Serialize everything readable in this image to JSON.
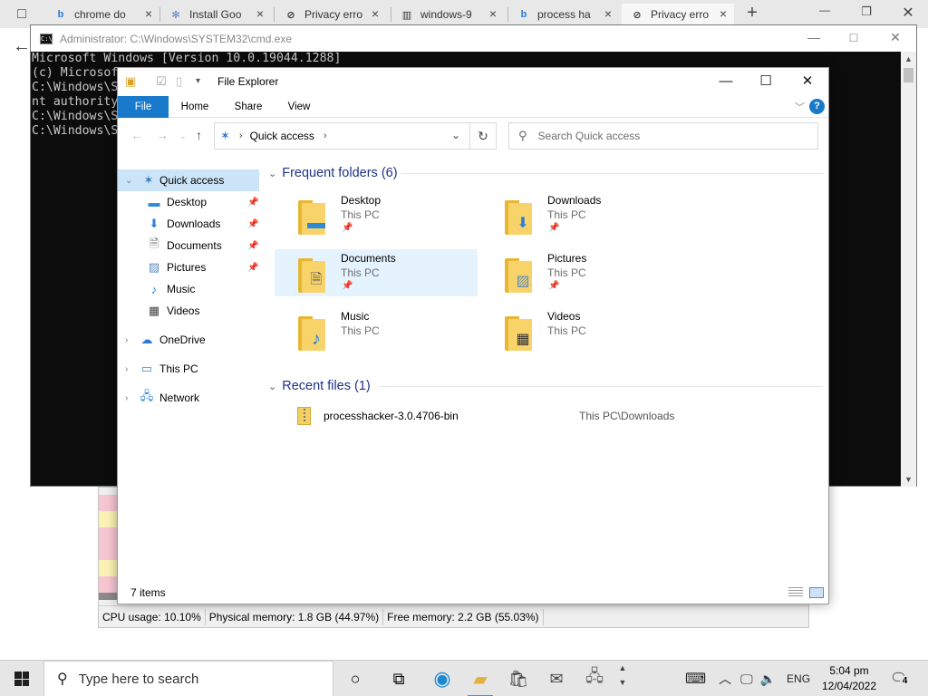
{
  "browser": {
    "tabs": [
      {
        "label": "chrome do",
        "icon": "bing-icon"
      },
      {
        "label": "Install Goo",
        "icon": "google-cloud-icon"
      },
      {
        "label": "Privacy erro",
        "icon": "privacy-error-icon"
      },
      {
        "label": "windows-9",
        "icon": "archive-icon"
      },
      {
        "label": "process ha",
        "icon": "bing-icon"
      },
      {
        "label": "Privacy erro",
        "icon": "privacy-error-icon"
      }
    ],
    "new_tab": "+"
  },
  "cmd": {
    "title": "Administrator: C:\\Windows\\SYSTEM32\\cmd.exe",
    "lines": [
      "Microsoft Windows [Version 10.0.19044.1288]",
      "(c) Microsof",
      "",
      "C:\\Windows\\S",
      "nt authority",
      "",
      "C:\\Windows\\S",
      "",
      "C:\\Windows\\S"
    ]
  },
  "process_hacker": {
    "status": [
      "CPU usage: 10.10%",
      "Physical memory: 1.8 GB (44.97%)",
      "Free memory: 2.2 GB (55.03%)"
    ]
  },
  "explorer": {
    "title": "File Explorer",
    "ribbon_tabs": [
      "File",
      "Home",
      "Share",
      "View"
    ],
    "help": "?",
    "address": {
      "location": "Quick access"
    },
    "search_placeholder": "Search Quick access",
    "nav": {
      "quick_access": "Quick access",
      "pinned": [
        "Desktop",
        "Downloads",
        "Documents",
        "Pictures"
      ],
      "unpinned": [
        "Music",
        "Videos"
      ],
      "onedrive": "OneDrive",
      "this_pc": "This PC",
      "network": "Network"
    },
    "frequent": {
      "header": "Frequent folders (6)",
      "items": [
        {
          "name": "Desktop",
          "location": "This PC",
          "pinned": true
        },
        {
          "name": "Downloads",
          "location": "This PC",
          "pinned": true
        },
        {
          "name": "Documents",
          "location": "This PC",
          "pinned": true
        },
        {
          "name": "Pictures",
          "location": "This PC",
          "pinned": true
        },
        {
          "name": "Music",
          "location": "This PC",
          "pinned": false
        },
        {
          "name": "Videos",
          "location": "This PC",
          "pinned": false
        }
      ]
    },
    "recent": {
      "header": "Recent files (1)",
      "items": [
        {
          "name": "processhacker-3.0.4706-bin",
          "path": "This PC\\Downloads"
        }
      ]
    },
    "status": {
      "items": "7 items"
    }
  },
  "taskbar": {
    "search_placeholder": "Type here to search",
    "language": "ENG",
    "time": "5:04 pm",
    "date": "12/04/2022",
    "notifications": "4"
  },
  "colors": {
    "accent": "#1979ca",
    "selection": "#cce4f7",
    "folder": "#f8d36a",
    "group_header": "#1e3287"
  }
}
